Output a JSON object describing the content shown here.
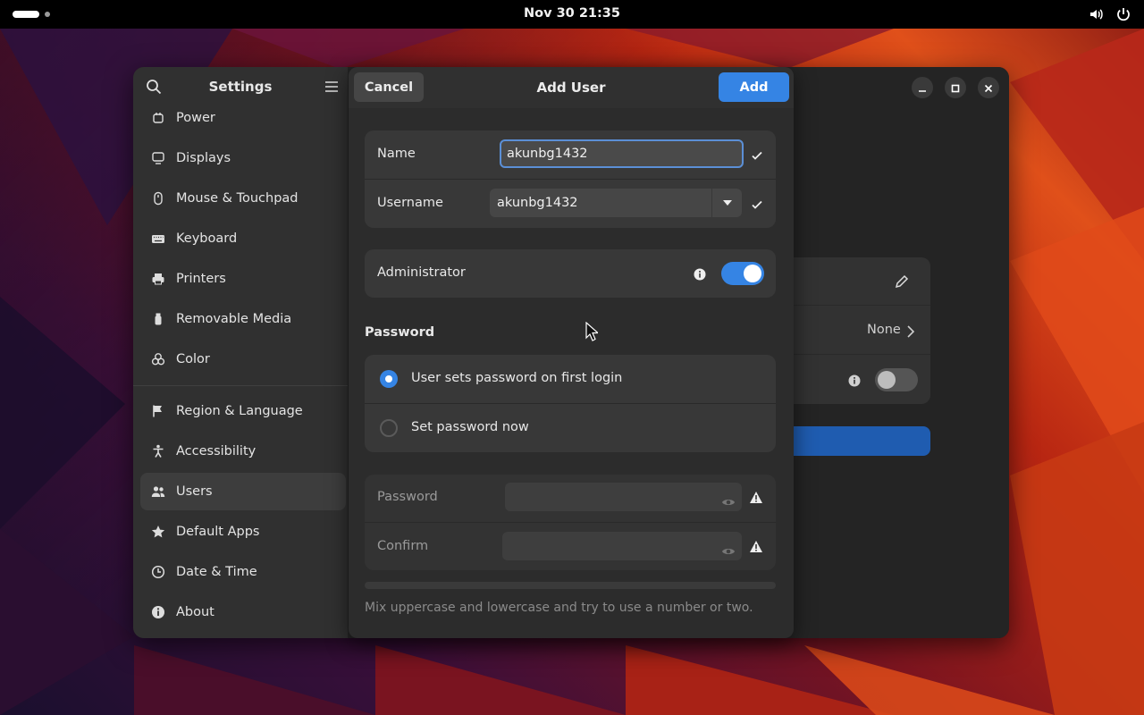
{
  "topbar": {
    "clock": "Nov 30  21:35"
  },
  "sidebar": {
    "title": "Settings",
    "items": [
      {
        "label": "Power",
        "icon": "power-icon"
      },
      {
        "label": "Displays",
        "icon": "display-icon"
      },
      {
        "label": "Mouse & Touchpad",
        "icon": "mouse-icon"
      },
      {
        "label": "Keyboard",
        "icon": "keyboard-icon"
      },
      {
        "label": "Printers",
        "icon": "printer-icon"
      },
      {
        "label": "Removable Media",
        "icon": "usb-icon"
      },
      {
        "label": "Color",
        "icon": "color-icon"
      },
      {
        "label": "Region & Language",
        "icon": "flag-icon"
      },
      {
        "label": "Accessibility",
        "icon": "accessibility-icon"
      },
      {
        "label": "Users",
        "icon": "users-icon"
      },
      {
        "label": "Default Apps",
        "icon": "star-icon"
      },
      {
        "label": "Date & Time",
        "icon": "clock-icon"
      },
      {
        "label": "About",
        "icon": "info-icon"
      }
    ],
    "active": "Users"
  },
  "background_panel": {
    "autologin_value": "None"
  },
  "dialog": {
    "title": "Add User",
    "cancel_label": "Cancel",
    "add_label": "Add",
    "name_label": "Name",
    "name_value": "akunbg1432",
    "username_label": "Username",
    "username_value": "akunbg1432",
    "admin_label": "Administrator",
    "admin_enabled": true,
    "password_section": "Password",
    "radio_first_login": "User sets password on first login",
    "radio_set_now": "Set password now",
    "password_label": "Password",
    "confirm_label": "Confirm",
    "hint": "Mix uppercase and lowercase and try to use a number or two."
  },
  "colors": {
    "accent": "#3584e4",
    "window_bg": "#242424",
    "sidebar_bg": "#303030",
    "card_bg": "#383838"
  }
}
